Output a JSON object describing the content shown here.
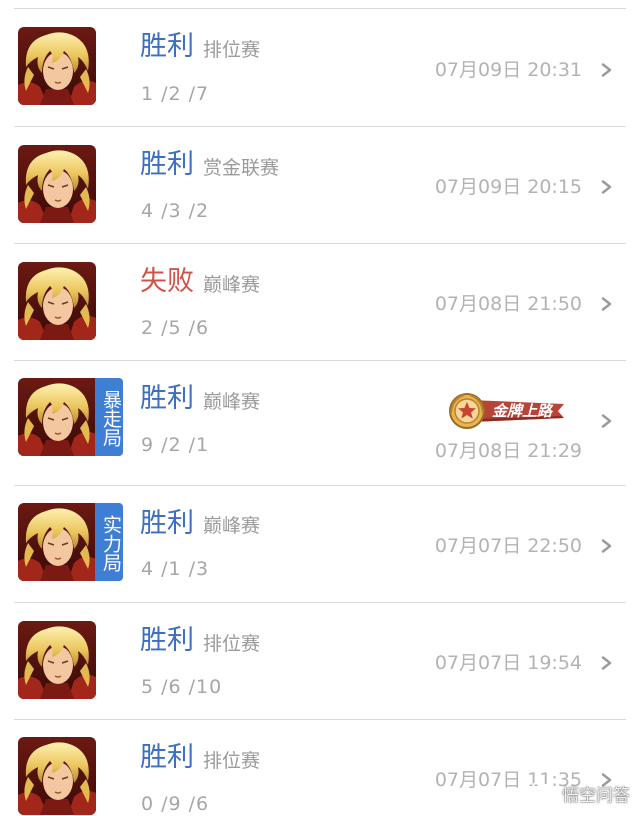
{
  "matches": [
    {
      "result": "胜利",
      "outcome": "win",
      "match_type": "排位赛",
      "kda": "1 /2 /7",
      "time": "07月09日 20:31",
      "mode_badge": "",
      "medal": ""
    },
    {
      "result": "胜利",
      "outcome": "win",
      "match_type": "赏金联赛",
      "kda": "4 /3 /2",
      "time": "07月09日 20:15",
      "mode_badge": "",
      "medal": ""
    },
    {
      "result": "失败",
      "outcome": "loss",
      "match_type": "巅峰赛",
      "kda": "2 /5 /6",
      "time": "07月08日 21:50",
      "mode_badge": "",
      "medal": ""
    },
    {
      "result": "胜利",
      "outcome": "win",
      "match_type": "巅峰赛",
      "kda": "9 /2 /1",
      "time": "07月08日 21:29",
      "mode_badge": "暴走局",
      "medal": "金牌上路"
    },
    {
      "result": "胜利",
      "outcome": "win",
      "match_type": "巅峰赛",
      "kda": "4 /1 /3",
      "time": "07月07日 22:50",
      "mode_badge": "实力局",
      "medal": ""
    },
    {
      "result": "胜利",
      "outcome": "win",
      "match_type": "排位赛",
      "kda": "5 /6 /10",
      "time": "07月07日 19:54",
      "mode_badge": "",
      "medal": ""
    },
    {
      "result": "胜利",
      "outcome": "win",
      "match_type": "排位赛",
      "kda": "0 /9 /6",
      "time": "07月07日 11:35",
      "mode_badge": "",
      "medal": ""
    }
  ],
  "watermark": {
    "text": "悟空问答",
    "icon": "wukong-logo-icon"
  },
  "colors": {
    "win": "#3a6fc4",
    "loss": "#d0524a",
    "badge": "#3f7fd3"
  }
}
